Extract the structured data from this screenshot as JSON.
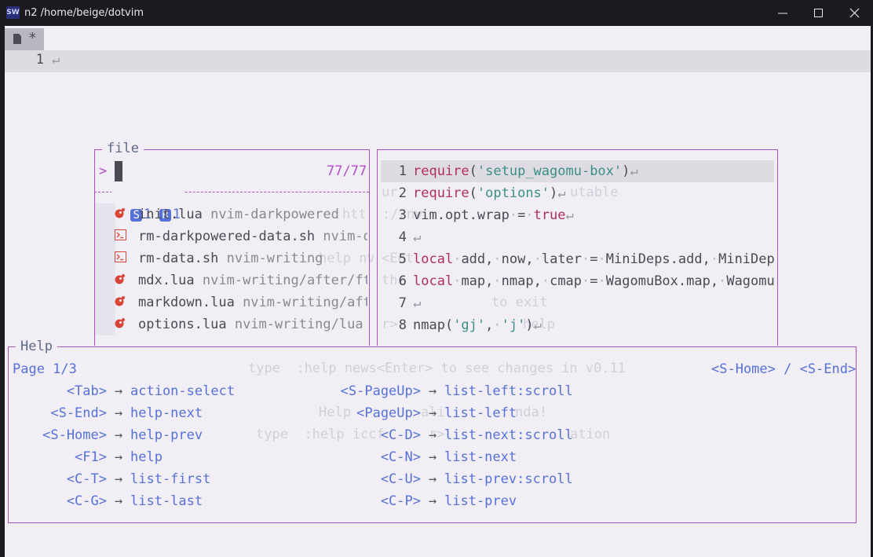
{
  "window": {
    "icon_text": "SW",
    "title": "n2 /home/beige/dotvim"
  },
  "tabline": {
    "modified_marker": "*"
  },
  "buffer": {
    "line_number": "1",
    "eol_marker": "↵"
  },
  "background_intro": [
    "ur",
    "utable",
    "htt  ://nv",
    "help nv",
    "<Ent",
    "the",
    "to exit",
    "r>",
    "help",
    "type  :help news<Enter> to see changes in v0.11",
    "Help",
    "ali",
    "nda!",
    "type  :help iccf",
    "r>",
    "ation"
  ],
  "picker": {
    "title": "file",
    "prompt": ">",
    "count": "77/77",
    "badges": [
      {
        "letter": "S",
        "value": "1"
      },
      {
        "letter": "R",
        "value": "1"
      }
    ],
    "items": [
      {
        "icon": "lua",
        "name": "init.lua",
        "path": "nvim-darkpowered"
      },
      {
        "icon": "sh",
        "name": "rm-darkpowered-data.sh",
        "path": "nvim-d"
      },
      {
        "icon": "sh",
        "name": "rm-data.sh",
        "path": "nvim-writing"
      },
      {
        "icon": "lua",
        "name": "mdx.lua",
        "path": "nvim-writing/after/ft"
      },
      {
        "icon": "lua",
        "name": "markdown.lua",
        "path": "nvim-writing/aft"
      },
      {
        "icon": "lua",
        "name": "options.lua",
        "path": "nvim-writing/lua"
      }
    ]
  },
  "preview": {
    "lines": [
      {
        "n": "1",
        "html": "<span class=\"kw\">require</span>(<span class=\"str\">'setup_wagomu-box'</span>)<span class=\"eol\">↵</span>"
      },
      {
        "n": "2",
        "html": "<span class=\"kw\">require</span>(<span class=\"str\">'options'</span>)<span class=\"eol\">↵</span>"
      },
      {
        "n": "3",
        "html": "vim.opt.wrap<span class=\"space\">·</span>=<span class=\"space\">·</span><span class=\"kw\">true</span><span class=\"eol\">↵</span>"
      },
      {
        "n": "4",
        "html": "<span class=\"eol\">↵</span>"
      },
      {
        "n": "5",
        "html": "<span class=\"kw\">local</span><span class=\"space\">·</span>add,<span class=\"space\">·</span>now,<span class=\"space\">·</span>later<span class=\"space\">·</span>=<span class=\"space\">·</span>MiniDeps.add,<span class=\"space\">·</span>MiniDep<span class=\"space\">»</span>"
      },
      {
        "n": "6",
        "html": "<span class=\"kw\">local</span><span class=\"space\">·</span>map,<span class=\"space\">·</span>nmap,<span class=\"space\">·</span>cmap<span class=\"space\">·</span>=<span class=\"space\">·</span>WagomuBox.map,<span class=\"space\">·</span>Wagomu<span class=\"space\">»</span>"
      },
      {
        "n": "7",
        "html": "<span class=\"eol\">↵</span>"
      },
      {
        "n": "8",
        "html": "nmap(<span class=\"str\">'gj'</span>,<span class=\"space\">·</span><span class=\"str\">'j'</span>)<span class=\"eol\">↵</span>"
      }
    ]
  },
  "help": {
    "title": "Help",
    "page": "Page 1/3",
    "nav": "<S-Home> / <S-End>",
    "left": [
      {
        "key": "<Tab>",
        "arrow": "→",
        "action": "action-select"
      },
      {
        "key": "<S-End>",
        "arrow": "→",
        "action": "help-next"
      },
      {
        "key": "<S-Home>",
        "arrow": "→",
        "action": "help-prev"
      },
      {
        "key": "<F1>",
        "arrow": "→",
        "action": "help"
      },
      {
        "key": "<C-T>",
        "arrow": "→",
        "action": "list-first"
      },
      {
        "key": "<C-G>",
        "arrow": "→",
        "action": "list-last"
      }
    ],
    "right": [
      {
        "key": "<S-PageUp>",
        "arrow": "→",
        "action": "list-left:scroll"
      },
      {
        "key": "<PageUp>",
        "arrow": "→",
        "action": "list-left"
      },
      {
        "key": "<C-D>",
        "arrow": "→",
        "action": "list-next:scroll"
      },
      {
        "key": "<C-N>",
        "arrow": "→",
        "action": "list-next"
      },
      {
        "key": "<C-U>",
        "arrow": "→",
        "action": "list-prev:scroll"
      },
      {
        "key": "<C-P>",
        "arrow": "→",
        "action": "list-prev"
      }
    ]
  }
}
